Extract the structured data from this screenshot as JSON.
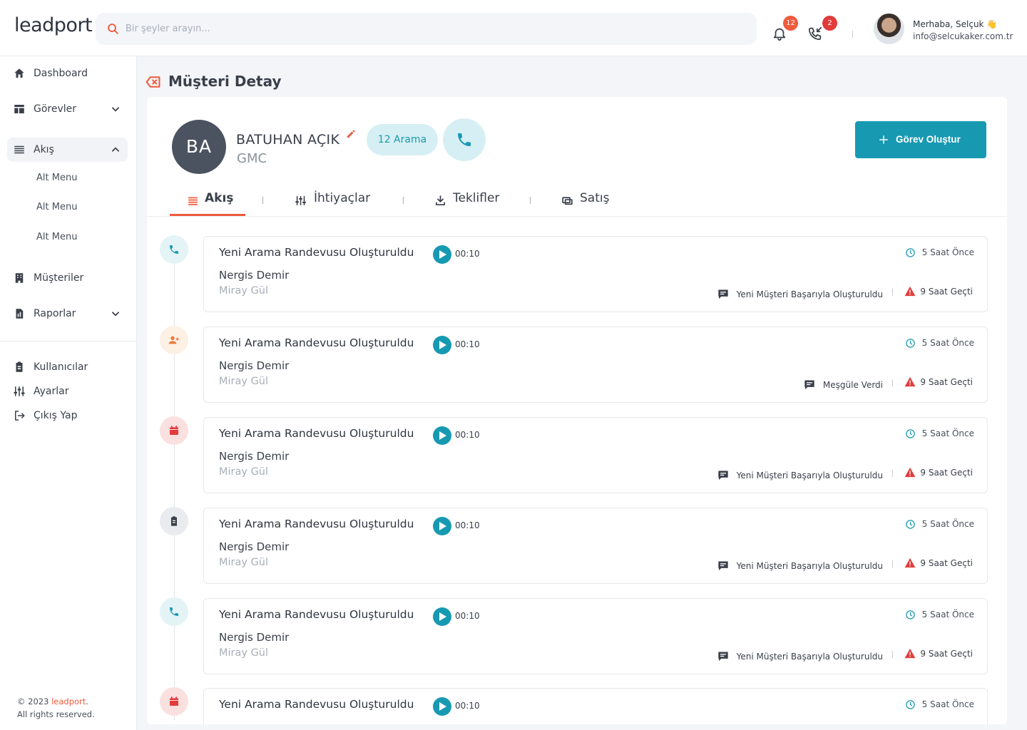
{
  "brand": {
    "logo_text": "leadport",
    "accent": "#ee5a3c",
    "primary": "#1899b2"
  },
  "topbar": {
    "search_placeholder": "Bir şeyler arayın...",
    "notifications_count": "12",
    "missed_calls_count": "2",
    "greeting": "Merhaba, Selçuk 👋",
    "email": "info@selcukaker.com.tr"
  },
  "sidebar": {
    "dashboard": "Dashboard",
    "gorevler": "Görevler",
    "akis": "Akış",
    "sub_items": [
      "Alt Menu",
      "Alt Menu",
      "Alt Menu"
    ],
    "musteriler": "Müşteriler",
    "raporlar": "Raporlar",
    "kullanicilar": "Kullanıcılar",
    "ayarlar": "Ayarlar",
    "cikis": "Çıkış Yap",
    "copyright_prefix": "© 2023 ",
    "copyright_brand": "leadport",
    "copyright_suffix": ".",
    "rights": "All rights reserved."
  },
  "page": {
    "title": "Müşteri Detay"
  },
  "customer": {
    "initials": "BA",
    "name": "BATUHAN AÇIK",
    "company": "GMC",
    "call_count_label": "12 Arama",
    "create_task_label": "Görev Oluştur"
  },
  "tabs": [
    "Akış",
    "İhtiyaçlar",
    "Teklifler",
    "Satış"
  ],
  "activities": [
    {
      "icon": "phone-icon",
      "title": "Yeni Arama Randevusu Oluşturuldu",
      "duration": "00:10",
      "time_ago": "5 Saat Önce",
      "person": "Nergis Demir",
      "agent": "Miray Gül",
      "status": "Yeni Müşteri Başarıyla Oluşturuldu",
      "elapsed": "9 Saat Geçti"
    },
    {
      "icon": "user-add-icon",
      "title": "Yeni Arama Randevusu Oluşturuldu",
      "duration": "00:10",
      "time_ago": "5 Saat Önce",
      "person": "Nergis Demir",
      "agent": "Miray Gül",
      "status": "Meşgüle Verdi",
      "elapsed": "9 Saat Geçti"
    },
    {
      "icon": "calendar-icon",
      "title": "Yeni Arama Randevusu Oluşturuldu",
      "duration": "00:10",
      "time_ago": "5 Saat Önce",
      "person": "Nergis Demir",
      "agent": "Miray Gül",
      "status": "Yeni Müşteri Başarıyla Oluşturuldu",
      "elapsed": "9 Saat Geçti"
    },
    {
      "icon": "clipboard-icon",
      "title": "Yeni Arama Randevusu Oluşturuldu",
      "duration": "00:10",
      "time_ago": "5 Saat Önce",
      "person": "Nergis Demir",
      "agent": "Miray Gül",
      "status": "Yeni Müşteri Başarıyla Oluşturuldu",
      "elapsed": "9 Saat Geçti"
    },
    {
      "icon": "phone-icon",
      "title": "Yeni Arama Randevusu Oluşturuldu",
      "duration": "00:10",
      "time_ago": "5 Saat Önce",
      "person": "Nergis Demir",
      "agent": "Miray Gül",
      "status": "Yeni Müşteri Başarıyla Oluşturuldu",
      "elapsed": "9 Saat Geçti"
    },
    {
      "icon": "calendar-icon",
      "title": "Yeni Arama Randevusu Oluşturuldu",
      "duration": "00:10",
      "time_ago": "5 Saat Önce"
    }
  ]
}
